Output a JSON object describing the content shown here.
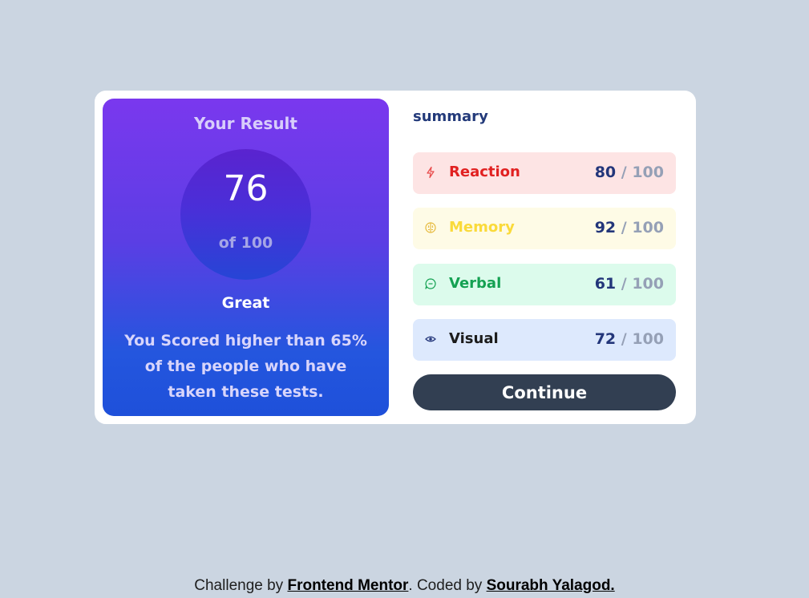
{
  "result": {
    "title": "Your Result",
    "score": "76",
    "score_of": "of 100",
    "rating": "Great",
    "description": "You Scored higher than 65% of the people who have taken these tests."
  },
  "summary": {
    "title": "summary",
    "categories": [
      {
        "name": "Reaction",
        "score": "80",
        "max": "100",
        "icon": "lightning-icon",
        "color": "#e12121",
        "bg": "#fde4e4"
      },
      {
        "name": "Memory",
        "score": "92",
        "max": "100",
        "icon": "brain-icon",
        "color": "#fada3a",
        "bg": "#fefbe6"
      },
      {
        "name": "Verbal",
        "score": "61",
        "max": "100",
        "icon": "chat-bubble-icon",
        "color": "#14a152",
        "bg": "#dcfbec"
      },
      {
        "name": "Visual",
        "score": "72",
        "max": "100",
        "icon": "eye-icon",
        "color": "#1c1c1c",
        "bg": "#dde9fd"
      }
    ],
    "continue_label": "Continue"
  },
  "footer": {
    "prefix": "Challenge by ",
    "link1": "Frontend Mentor",
    "middle": ". Coded by ",
    "link2": "Sourabh Yalagod."
  }
}
